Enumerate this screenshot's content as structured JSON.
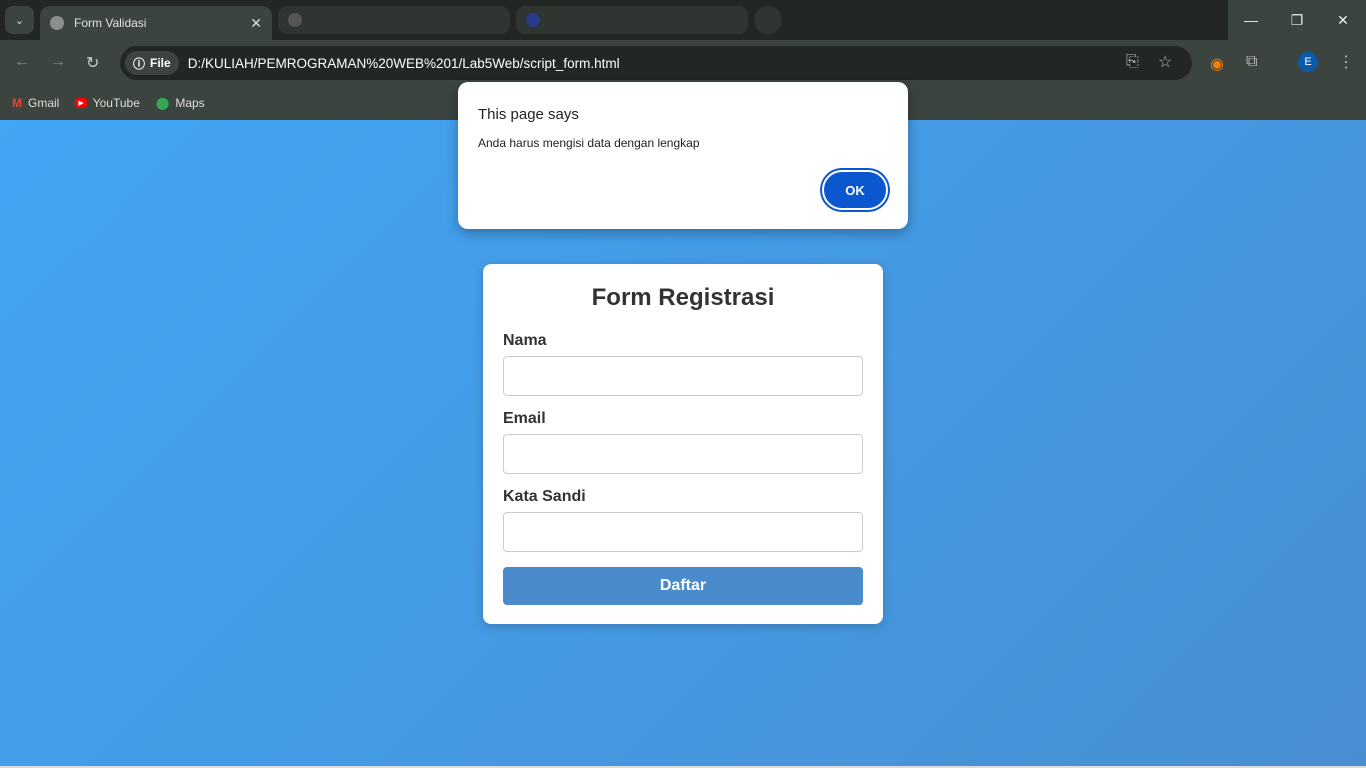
{
  "browser": {
    "tab_title": "Form Validasi",
    "file_chip": "File",
    "url": "D:/KULIAH/PEMROGRAMAN%20WEB%201/Lab5Web/script_form.html",
    "avatar_letter": "E",
    "bookmarks": [
      {
        "label": "Gmail",
        "color": "#ea4335"
      },
      {
        "label": "YouTube",
        "color": "#ff0000"
      },
      {
        "label": "Maps",
        "color": "#34a853"
      }
    ]
  },
  "dialog": {
    "title": "This page says",
    "message": "Anda harus mengisi data dengan lengkap",
    "ok_label": "OK"
  },
  "form": {
    "title": "Form Registrasi",
    "fields": [
      {
        "label": "Nama",
        "value": ""
      },
      {
        "label": "Email",
        "value": ""
      },
      {
        "label": "Kata Sandi",
        "value": ""
      }
    ],
    "submit_label": "Daftar"
  }
}
